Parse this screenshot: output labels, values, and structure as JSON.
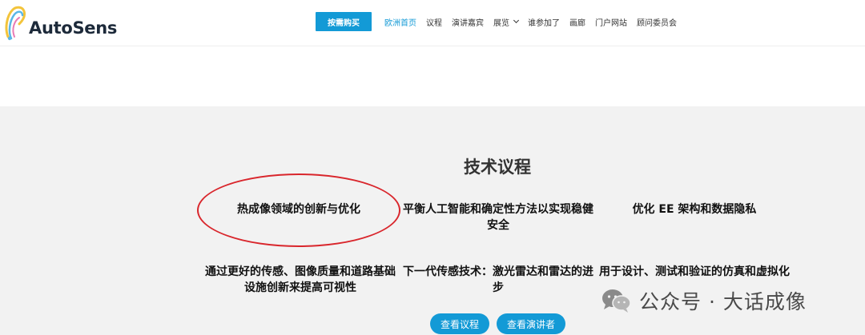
{
  "header": {
    "logo_text": "AutoSens",
    "buy_button": "按需购买",
    "nav": [
      {
        "label": "欧洲首页",
        "active": true
      },
      {
        "label": "议程"
      },
      {
        "label": "演讲嘉宾"
      },
      {
        "label": "展览",
        "dropdown": true
      },
      {
        "label": "谁参加了"
      },
      {
        "label": "画廊"
      },
      {
        "label": "门户网站"
      },
      {
        "label": "顾问委员会"
      }
    ]
  },
  "agenda": {
    "title": "技术议程",
    "topics": [
      "热成像领域的创新与优化",
      "平衡人工智能和确定性方法以实现稳健安全",
      "优化 EE 架构和数据隐私",
      "通过更好的传感、图像质量和道路基础设施创新来提高可视性",
      "下一代传感技术：激光雷达和雷达的进步",
      "用于设计、测试和验证的仿真和虚拟化"
    ],
    "buttons": {
      "view_agenda": "查看议程",
      "view_speakers": "查看演讲者"
    }
  },
  "watermark": {
    "text": "公众号 · 大话成像"
  },
  "colors": {
    "accent": "#139ad6",
    "highlight_circle": "#d9262c",
    "section_bg": "#f2f2f2"
  }
}
